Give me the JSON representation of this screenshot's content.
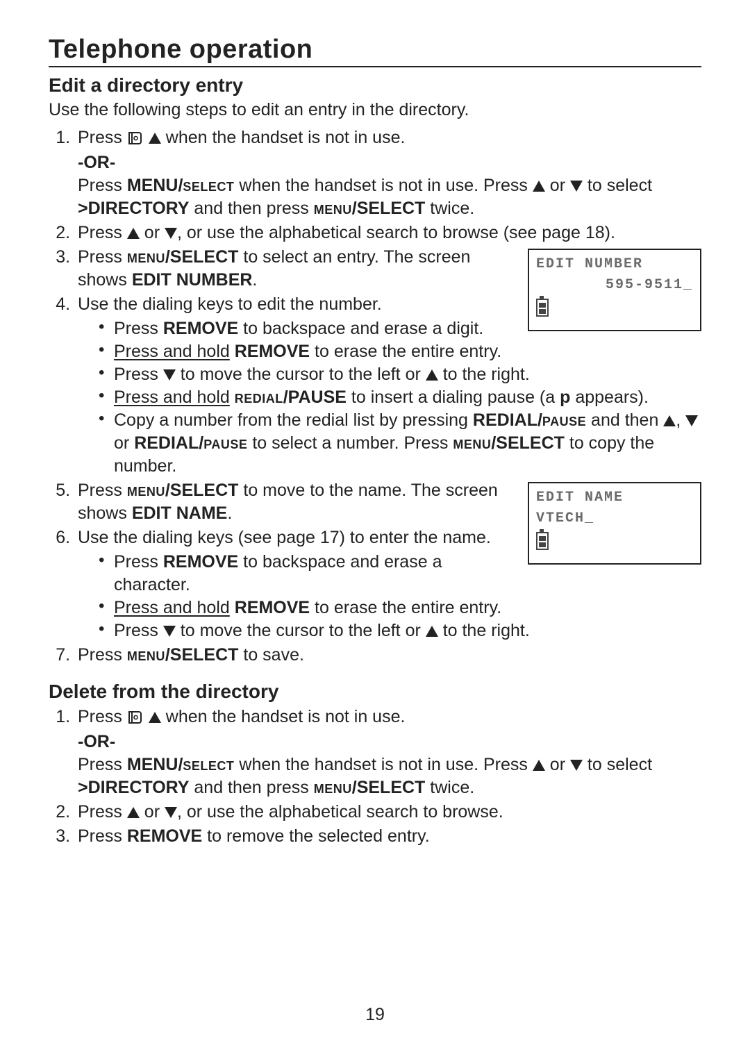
{
  "page_number": "19",
  "section_title": "Telephone operation",
  "edit": {
    "heading": "Edit a directory entry",
    "intro": "Use the following steps to edit an entry in the directory.",
    "step1a": "Press ",
    "step1b": " when the handset is not in use.",
    "or": "-OR-",
    "step1c_a": "Press ",
    "step1c_menu": "MENU/",
    "step1c_select_sc": "select",
    "step1c_b": " when the handset is not in use. Press ",
    "step1c_c": " or ",
    "step1c_d": "  to select ",
    "step1c_dir": ">DIRECTORY",
    "step1c_e": " and then press ",
    "step1c_menu2_sc": "menu",
    "step1c_select2": "/SELECT",
    "step1c_f": " twice.",
    "step2_a": "Press ",
    "step2_b": " or ",
    "step2_c": ", or use the alphabetical search to browse (see page 18).",
    "step3_a": "Press ",
    "step3_menu_sc": "menu",
    "step3_select": "/SELECT",
    "step3_b": " to select an entry. The screen shows ",
    "step3_label": "EDIT NUMBER",
    "step3_c": ".",
    "step4": "Use the dialing keys to edit the number.",
    "s4b1_a": "Press ",
    "s4b1_key": "REMOVE",
    "s4b1_b": " to backspace and erase a digit.",
    "s4b2_a": "Press and hold",
    "s4b2_sp": " ",
    "s4b2_key": "REMOVE",
    "s4b2_b": " to erase the entire entry.",
    "s4b3_a": "Press ",
    "s4b3_b": " to move the cursor to the left or ",
    "s4b3_c": " to the right.",
    "s4b4_a": "Press and hold",
    "s4b4_sp": " ",
    "s4b4_key_sc": "redial",
    "s4b4_key2": "/PAUSE",
    "s4b4_b": " to insert a dialing pause (a ",
    "s4b4_p": "p",
    "s4b4_c": " appears).",
    "s4b5_a": "Copy a number from the redial list by pressing ",
    "s4b5_key1": "REDIAL/",
    "s4b5_key1_sc": "pause",
    "s4b5_b": " and then ",
    "s4b5_c": ", ",
    "s4b5_d": " or ",
    "s4b5_key2": "REDIAL/",
    "s4b5_key2_sc": "pause",
    "s4b5_e": " to select a number. Press ",
    "s4b5_menu_sc": "menu",
    "s4b5_select": "/SELECT",
    "s4b5_f": " to copy the number.",
    "step5_a": "Press ",
    "step5_menu_sc": "menu",
    "step5_select": "/SELECT",
    "step5_b": " to move to the name. The screen shows ",
    "step5_label": "EDIT NAME",
    "step5_c": ".",
    "step6": "Use the dialing keys (see page 17) to enter the name.",
    "s6b1_a": "Press ",
    "s6b1_key": "REMOVE",
    "s6b1_b": " to backspace and erase a character.",
    "s6b2_a": "Press and hold",
    "s6b2_sp": " ",
    "s6b2_key": "REMOVE",
    "s6b2_b": " to erase the entire entry.",
    "s6b3_a": "Press ",
    "s6b3_b": " to move the cursor to the left or ",
    "s6b3_c": " to the right.",
    "step7_a": "Press ",
    "step7_menu_sc": "menu",
    "step7_select": "/SELECT",
    "step7_b": " to save."
  },
  "lcd1": {
    "line1": "EDIT NUMBER",
    "line2": "595-9511_"
  },
  "lcd2": {
    "line1": "EDIT NAME",
    "line2": "VTECH_"
  },
  "delete": {
    "heading": "Delete from the directory",
    "step1a": "Press ",
    "step1b": " when the handset is not in use.",
    "or": "-OR-",
    "step1c_a": "Press ",
    "step1c_menu": "MENU/",
    "step1c_select_sc": "select",
    "step1c_b": " when the handset is not in use. Press ",
    "step1c_c": " or ",
    "step1c_d": "  to select ",
    "step1c_dir": ">DIRECTORY",
    "step1c_e": " and then press ",
    "step1c_menu2_sc": "menu",
    "step1c_select2": "/SELECT",
    "step1c_f": " twice.",
    "step2_a": "Press ",
    "step2_b": " or ",
    "step2_c": ", or use the alphabetical search to browse.",
    "step3_a": "Press ",
    "step3_key": "REMOVE",
    "step3_b": " to remove the selected entry."
  }
}
